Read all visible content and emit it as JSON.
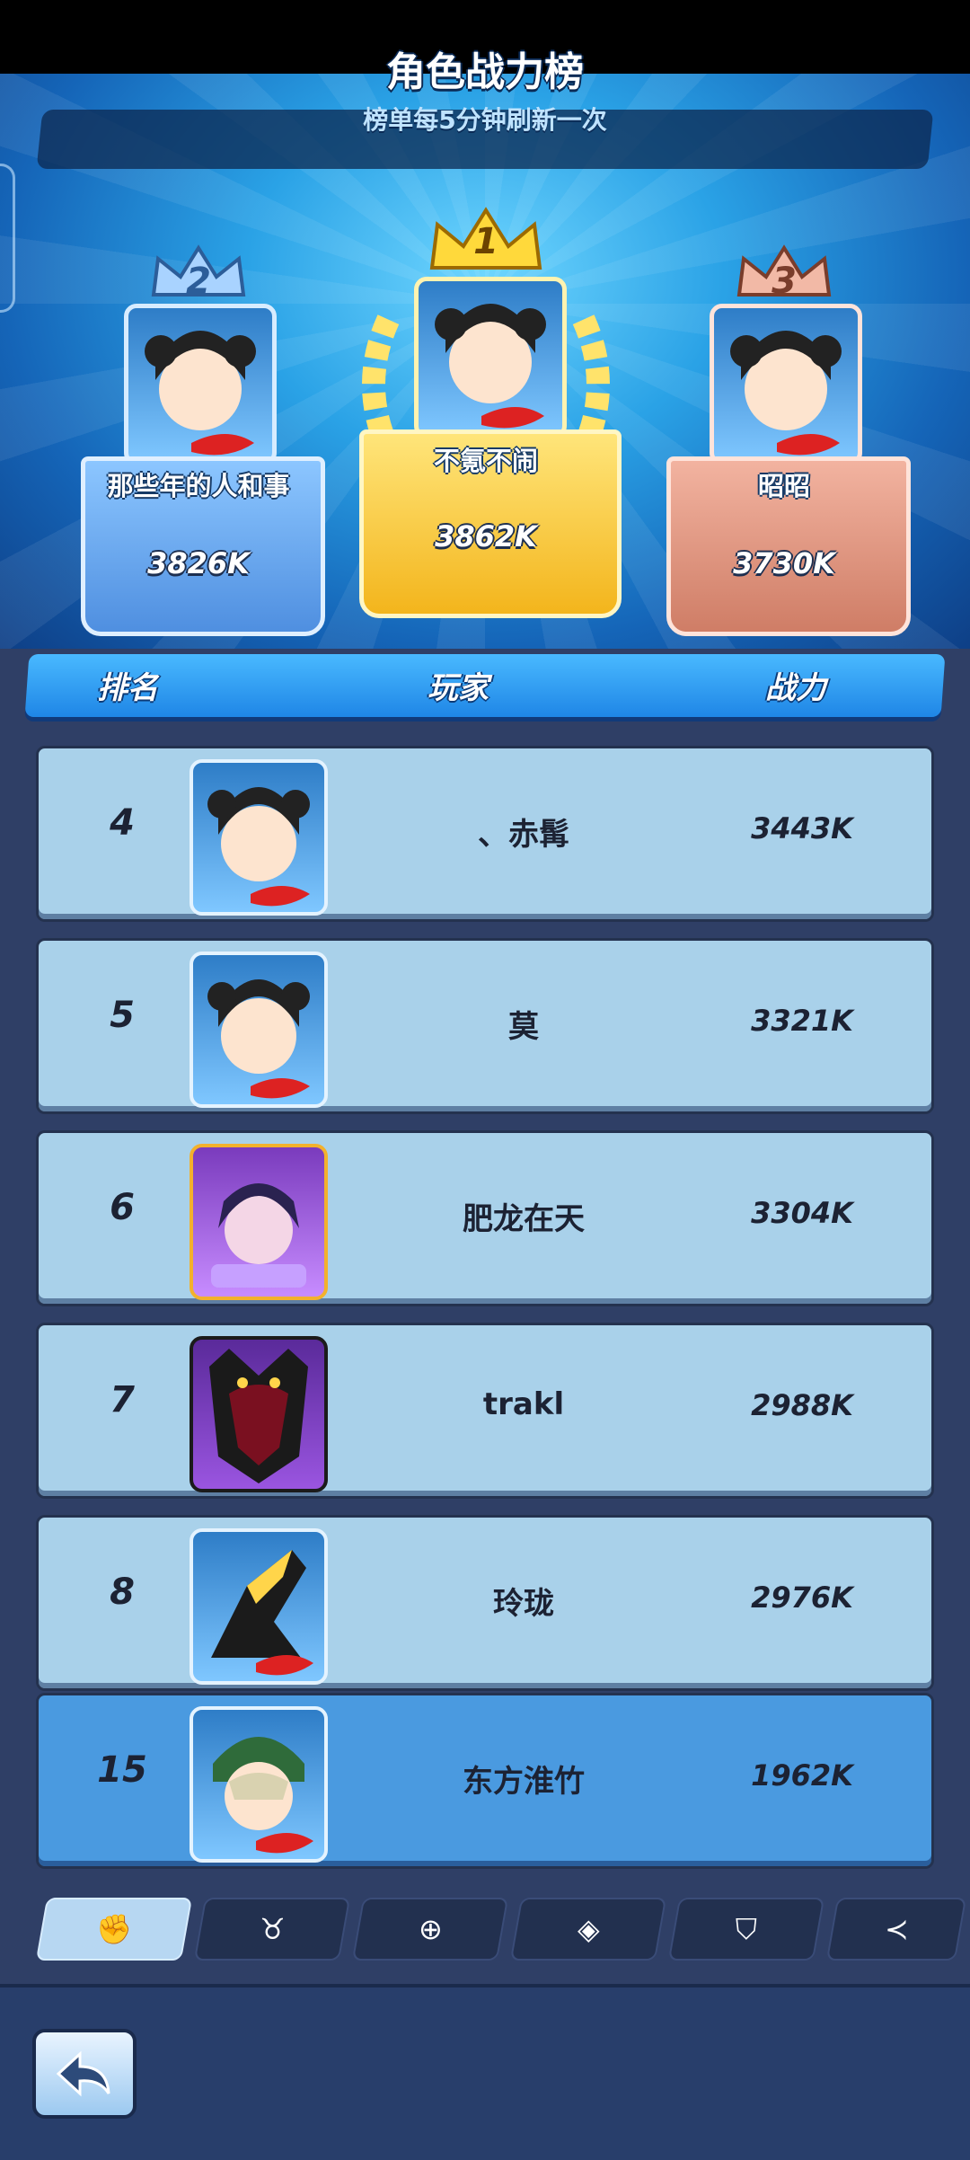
{
  "header": {
    "title": "角色战力榜",
    "subtitle": "榜单每5分钟刷新一次"
  },
  "podium": [
    {
      "rank": "2",
      "name": "那些年的人和事",
      "score": "3826K",
      "color": "#7db9ff"
    },
    {
      "rank": "1",
      "name": "不氪不闹",
      "score": "3862K",
      "color": "#ffd54a"
    },
    {
      "rank": "3",
      "name": "昭昭",
      "score": "3730K",
      "color": "#e6a189"
    }
  ],
  "columns": {
    "rank": "排名",
    "player": "玩家",
    "power": "战力"
  },
  "rows": [
    {
      "rank": "4",
      "name": "、赤髯",
      "score": "3443K",
      "avatar": "twin-bun-girl"
    },
    {
      "rank": "5",
      "name": "莫",
      "score": "3321K",
      "avatar": "twin-bun-girl"
    },
    {
      "rank": "6",
      "name": "肥龙在天",
      "score": "3304K",
      "avatar": "purple-hair-hero"
    },
    {
      "rank": "7",
      "name": "trakl",
      "score": "2988K",
      "avatar": "demon-mask"
    },
    {
      "rank": "8",
      "name": "玲珑",
      "score": "2976K",
      "avatar": "golden-beast"
    }
  ],
  "my_row": {
    "rank": "15",
    "name": "东方淮竹",
    "score": "1962K",
    "avatar": "green-hood-hero"
  },
  "tabs": [
    {
      "icon": "fist-icon",
      "glyph": "✊"
    },
    {
      "icon": "bull-icon",
      "glyph": "♉"
    },
    {
      "icon": "medal-icon",
      "glyph": "⊕"
    },
    {
      "icon": "card-icon",
      "glyph": "◈"
    },
    {
      "icon": "shield-icon",
      "glyph": "⛉"
    },
    {
      "icon": "share-icon",
      "glyph": "≺"
    }
  ]
}
